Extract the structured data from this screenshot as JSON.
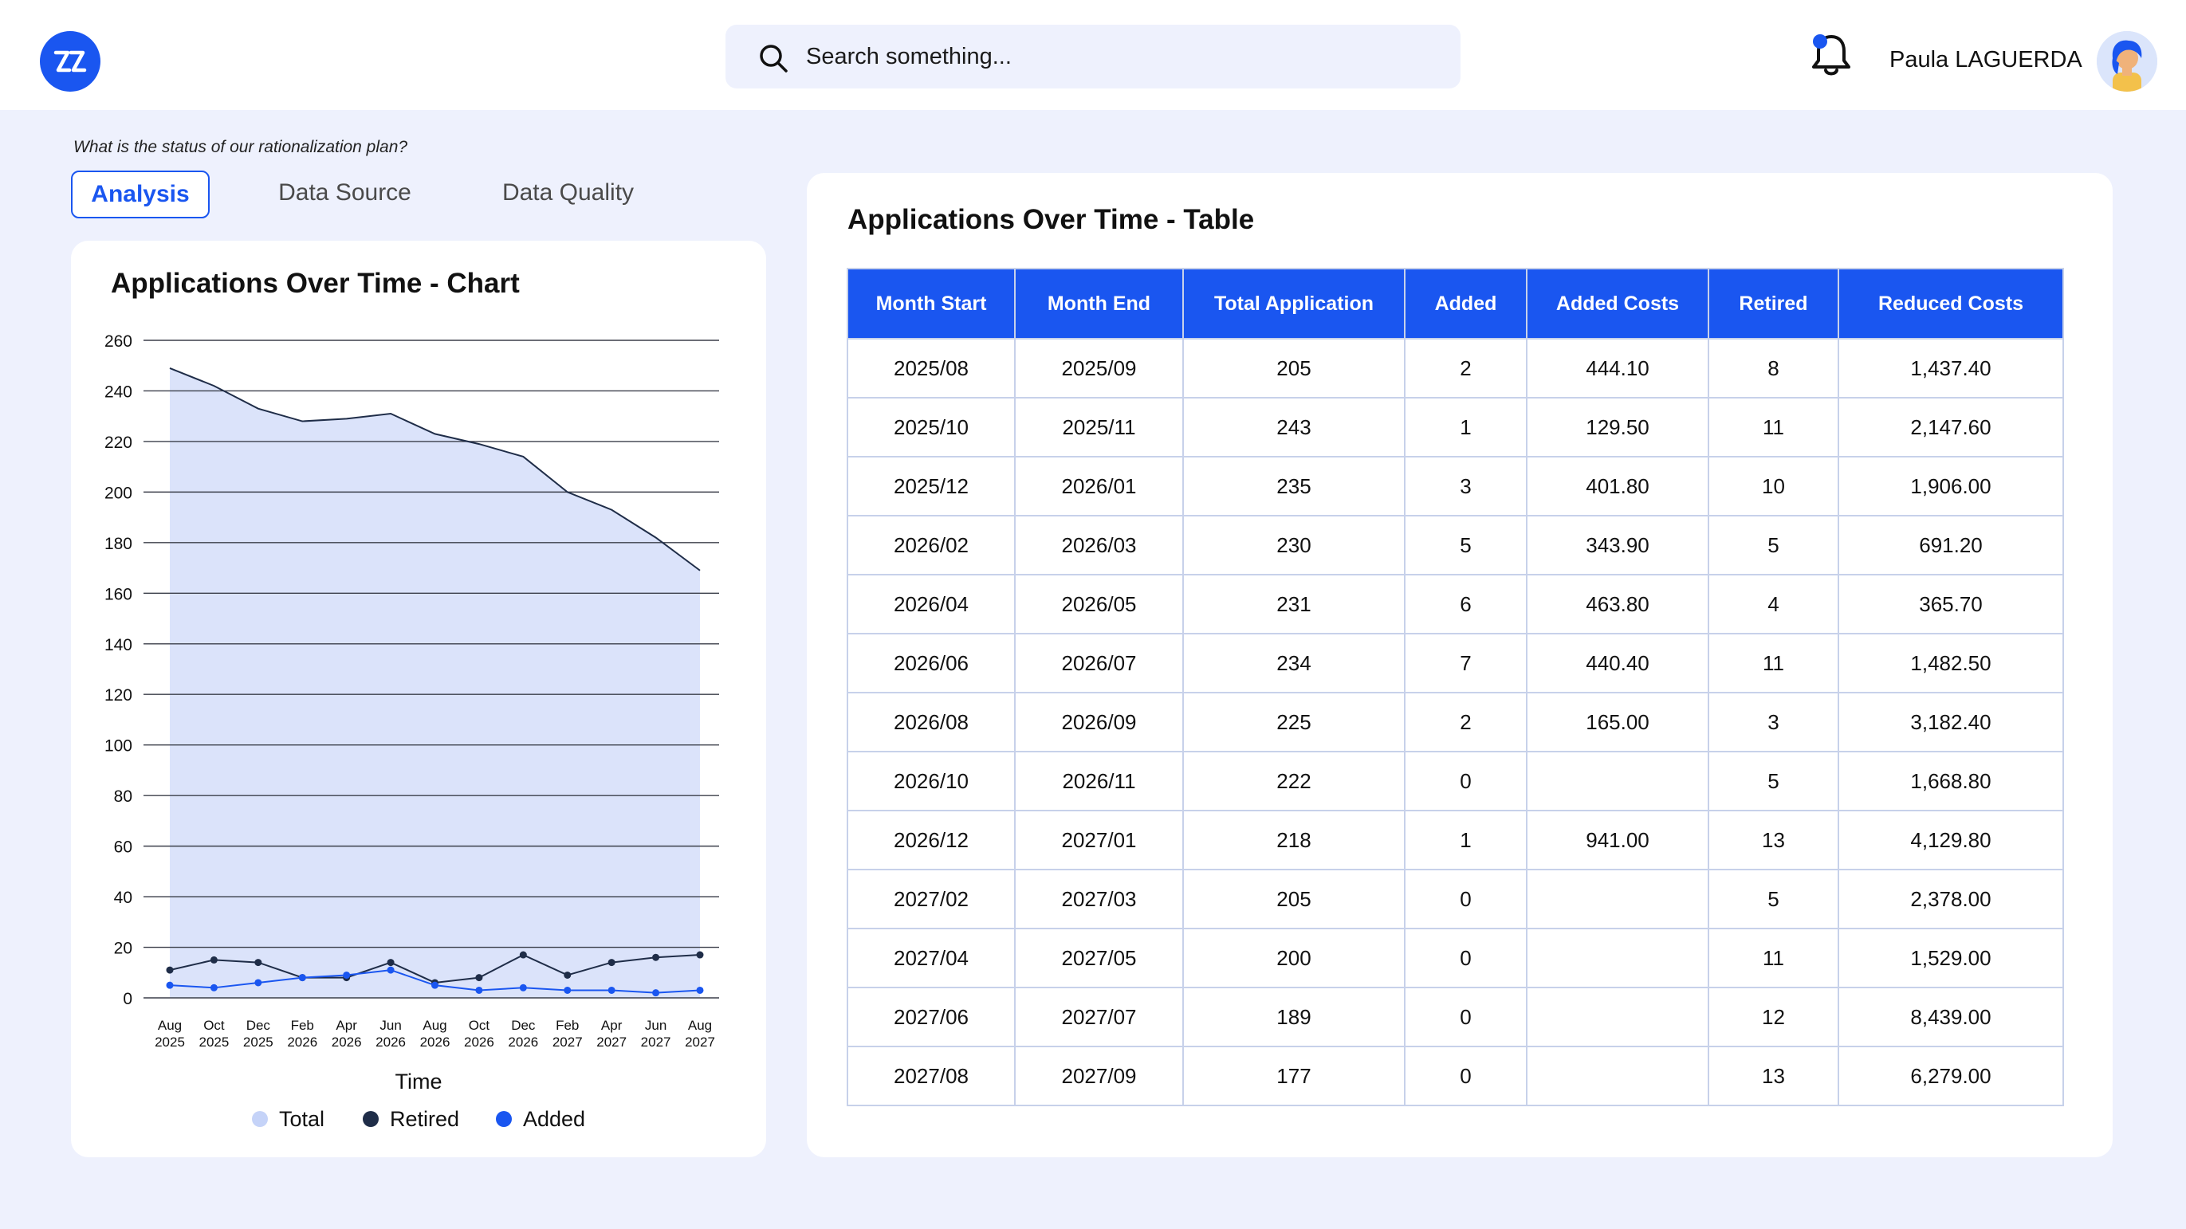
{
  "header": {
    "search_placeholder": "Search something...",
    "user_name": "Paula LAGUERDA",
    "logo_icon": "zz-logo-icon",
    "notification_icon": "bell-icon"
  },
  "question": "What is the status of our rationalization plan?",
  "tabs": [
    {
      "label": "Analysis",
      "active": true
    },
    {
      "label": "Data Source",
      "active": false
    },
    {
      "label": "Data Quality",
      "active": false
    }
  ],
  "chart_card": {
    "title": "Applications Over Time - Chart"
  },
  "table_card": {
    "title": "Applications Over Time - Table",
    "columns": [
      "Month Start",
      "Month End",
      "Total Application",
      "Added",
      "Added Costs",
      "Retired",
      "Reduced Costs"
    ],
    "rows": [
      [
        "2025/08",
        "2025/09",
        "205",
        "2",
        "444.10",
        "8",
        "1,437.40"
      ],
      [
        "2025/10",
        "2025/11",
        "243",
        "1",
        "129.50",
        "11",
        "2,147.60"
      ],
      [
        "2025/12",
        "2026/01",
        "235",
        "3",
        "401.80",
        "10",
        "1,906.00"
      ],
      [
        "2026/02",
        "2026/03",
        "230",
        "5",
        "343.90",
        "5",
        "691.20"
      ],
      [
        "2026/04",
        "2026/05",
        "231",
        "6",
        "463.80",
        "4",
        "365.70"
      ],
      [
        "2026/06",
        "2026/07",
        "234",
        "7",
        "440.40",
        "11",
        "1,482.50"
      ],
      [
        "2026/08",
        "2026/09",
        "225",
        "2",
        "165.00",
        "3",
        "3,182.40"
      ],
      [
        "2026/10",
        "2026/11",
        "222",
        "0",
        "",
        "5",
        "1,668.80"
      ],
      [
        "2026/12",
        "2027/01",
        "218",
        "1",
        "941.00",
        "13",
        "4,129.80"
      ],
      [
        "2027/02",
        "2027/03",
        "205",
        "0",
        "",
        "5",
        "2,378.00"
      ],
      [
        "2027/04",
        "2027/05",
        "200",
        "0",
        "",
        "11",
        "1,529.00"
      ],
      [
        "2027/06",
        "2027/07",
        "189",
        "0",
        "",
        "12",
        "8,439.00"
      ],
      [
        "2027/08",
        "2027/09",
        "177",
        "0",
        "",
        "13",
        "6,279.00"
      ]
    ]
  },
  "chart_data": {
    "type": "area",
    "title": "Applications Over Time - Chart",
    "xlabel": "Time",
    "ylabel": "",
    "ylim": [
      0,
      260
    ],
    "yticks": [
      0,
      20,
      40,
      60,
      80,
      100,
      120,
      140,
      160,
      180,
      200,
      220,
      240,
      260
    ],
    "categories": [
      [
        "Aug",
        "2025"
      ],
      [
        "Oct",
        "2025"
      ],
      [
        "Dec",
        "2025"
      ],
      [
        "Feb",
        "2026"
      ],
      [
        "Apr",
        "2026"
      ],
      [
        "Jun",
        "2026"
      ],
      [
        "Aug",
        "2026"
      ],
      [
        "Oct",
        "2026"
      ],
      [
        "Dec",
        "2026"
      ],
      [
        "Feb",
        "2027"
      ],
      [
        "Apr",
        "2027"
      ],
      [
        "Jun",
        "2027"
      ],
      [
        "Aug",
        "2027"
      ]
    ],
    "grid": true,
    "legend_position": "bottom",
    "series": [
      {
        "name": "Total",
        "color": "#c5d3f8",
        "fill": "#dbe3fa",
        "values": [
          249,
          242,
          233,
          228,
          229,
          231,
          223,
          219,
          214,
          200,
          193,
          182,
          169
        ]
      },
      {
        "name": "Retired",
        "color": "#1f2d48",
        "values": [
          11,
          15,
          14,
          8,
          8,
          14,
          6,
          8,
          17,
          9,
          14,
          16,
          17
        ]
      },
      {
        "name": "Added",
        "color": "#1a56f0",
        "values": [
          5,
          4,
          6,
          8,
          9,
          11,
          5,
          3,
          4,
          3,
          3,
          2,
          3
        ]
      }
    ]
  }
}
